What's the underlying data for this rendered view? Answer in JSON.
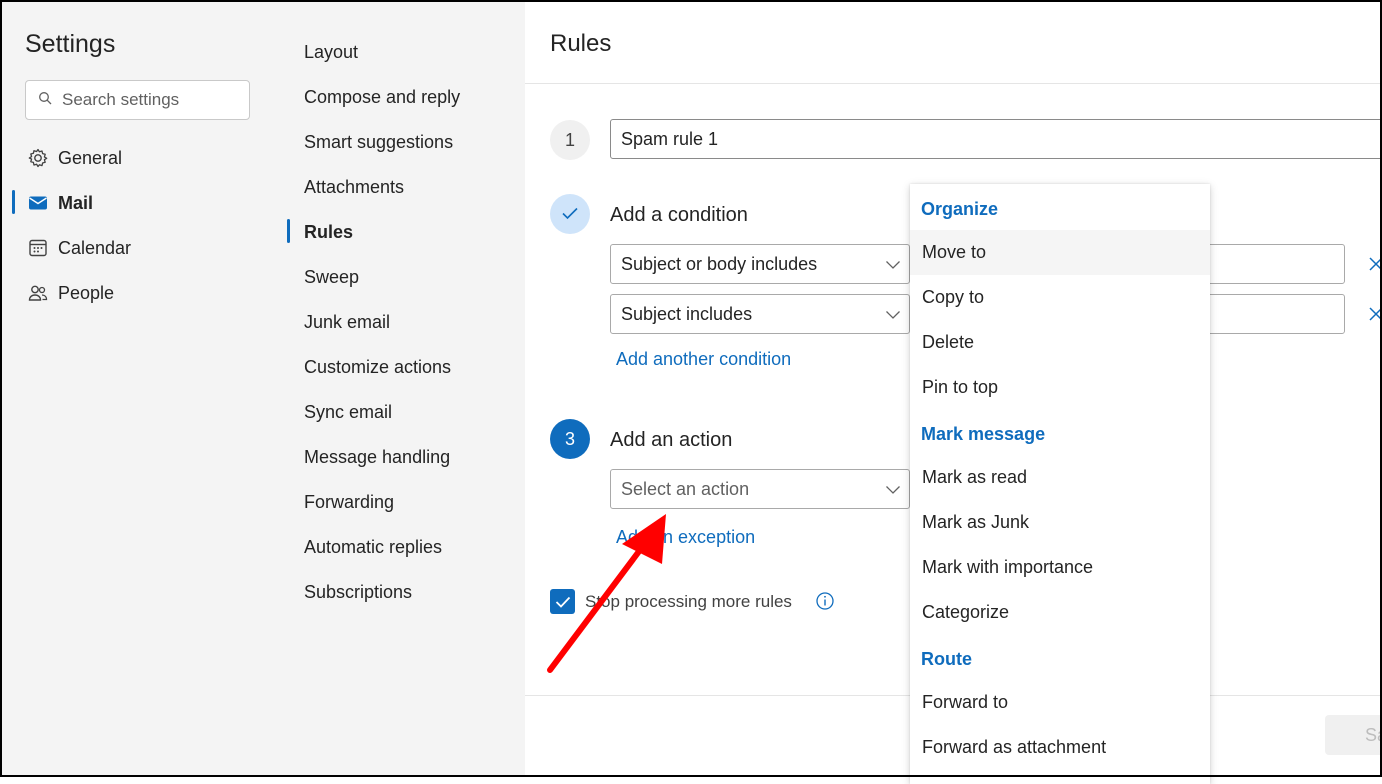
{
  "settings": {
    "title": "Settings",
    "search_placeholder": "Search settings",
    "nav": [
      {
        "label": "General",
        "icon": "gear-icon"
      },
      {
        "label": "Mail",
        "icon": "mail-icon"
      },
      {
        "label": "Calendar",
        "icon": "calendar-icon"
      },
      {
        "label": "People",
        "icon": "people-icon"
      }
    ],
    "active_nav": "Mail"
  },
  "mail_settings": {
    "items": [
      "Layout",
      "Compose and reply",
      "Smart suggestions",
      "Attachments",
      "Rules",
      "Sweep",
      "Junk email",
      "Customize actions",
      "Sync email",
      "Message handling",
      "Forwarding",
      "Automatic replies",
      "Subscriptions"
    ],
    "active_item": "Rules"
  },
  "rules": {
    "title": "Rules",
    "step1": {
      "number": "1",
      "rule_name": "Spam rule 1"
    },
    "step2": {
      "label": "Add a condition",
      "conditions": [
        "Subject or body includes",
        "Subject includes"
      ],
      "add_link": "Add another condition"
    },
    "step3": {
      "number": "3",
      "label": "Add an action",
      "action_placeholder": "Select an action",
      "exception_link": "Add an exception"
    },
    "stop_processing": {
      "label": "Stop processing more rules",
      "checked": true
    },
    "save_label": "Save"
  },
  "action_menu": {
    "groups": [
      {
        "header": "Organize",
        "items": [
          "Move to",
          "Copy to",
          "Delete",
          "Pin to top"
        ]
      },
      {
        "header": "Mark message",
        "items": [
          "Mark as read",
          "Mark as Junk",
          "Mark with importance",
          "Categorize"
        ]
      },
      {
        "header": "Route",
        "items": [
          "Forward to",
          "Forward as attachment"
        ]
      }
    ],
    "hovered_item": "Move to"
  },
  "colors": {
    "accent": "#0f6cbd",
    "annotation_arrow": "#ff0000"
  }
}
